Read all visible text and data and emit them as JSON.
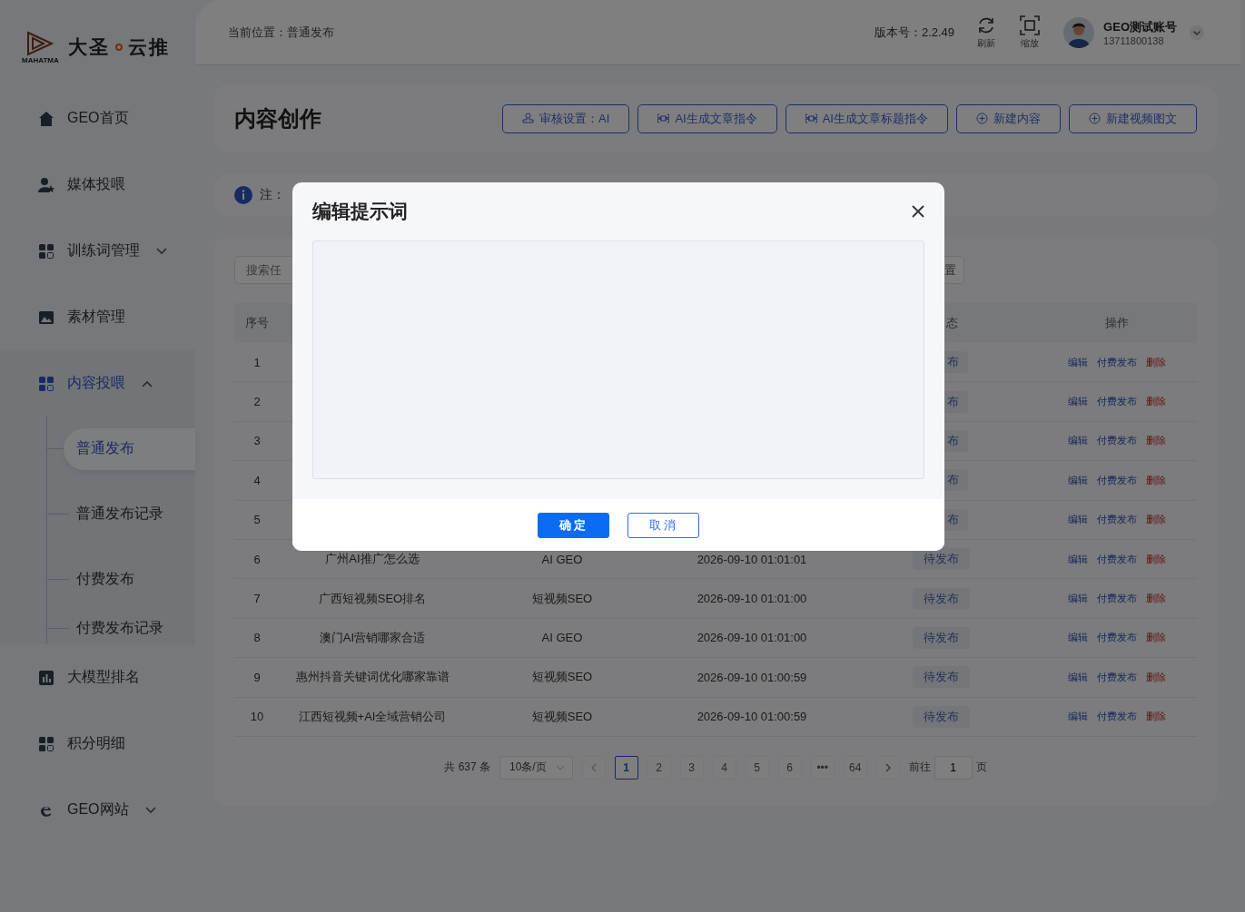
{
  "logo": {
    "caption": "MAHATMA",
    "name_left": "大圣",
    "name_right": "云推"
  },
  "sidebar": {
    "items": [
      {
        "label": "GEO首页",
        "selected": false
      },
      {
        "label": "媒体投喂",
        "selected": false
      },
      {
        "label": "训练词管理",
        "selected": false,
        "expanded": false
      },
      {
        "label": "素材管理",
        "selected": false
      },
      {
        "label": "内容投喂",
        "selected": true,
        "expanded": true,
        "children": [
          {
            "label": "普通发布",
            "selected": true
          },
          {
            "label": "普通发布记录",
            "selected": false
          },
          {
            "label": "付费发布",
            "selected": false
          },
          {
            "label": "付费发布记录",
            "selected": false
          }
        ]
      },
      {
        "label": "大模型排名",
        "selected": false
      },
      {
        "label": "积分明细",
        "selected": false
      },
      {
        "label": "GEO网站",
        "selected": false,
        "expanded": false
      }
    ]
  },
  "header": {
    "breadcrumb": "当前位置：普通发布",
    "version": "版本号：2.2.49",
    "tools": [
      "刷新",
      "缩放"
    ],
    "user": {
      "name": "GEO测试账号",
      "phone": "13711800138"
    }
  },
  "page_title": "内容创作",
  "actions": [
    "审核设置：AI",
    "AI生成文章指令",
    "AI生成文章标题指令",
    "新建内容",
    "新建视频图文"
  ],
  "notice": "注：",
  "search": {
    "placeholder": "搜索任",
    "button": "置"
  },
  "table": {
    "columns": [
      "序号",
      "态",
      "操作"
    ],
    "rows": [
      {
        "index": "1",
        "status": "布",
        "actions": [
          "编辑",
          "付费发布",
          "删除"
        ]
      },
      {
        "index": "2",
        "status": "布",
        "actions": [
          "编辑",
          "付费发布",
          "删除"
        ]
      },
      {
        "index": "3",
        "status": "布",
        "actions": [
          "编辑",
          "付费发布",
          "删除"
        ]
      },
      {
        "index": "4",
        "status": "布",
        "actions": [
          "编辑",
          "付费发布",
          "删除"
        ]
      },
      {
        "index": "5",
        "status": "布",
        "actions": [
          "编辑",
          "付费发布",
          "删除"
        ]
      },
      {
        "index": "6",
        "title": "广州AI推广怎么选",
        "type": "AI GEO",
        "time": "2026-09-10 01:01:01",
        "status": "待发布",
        "actions": [
          "编辑",
          "付费发布",
          "删除"
        ]
      },
      {
        "index": "7",
        "title": "广西短视频SEO排名",
        "type": "短视频SEO",
        "time": "2026-09-10 01:01:00",
        "status": "待发布",
        "actions": [
          "编辑",
          "付费发布",
          "删除"
        ]
      },
      {
        "index": "8",
        "title": "澳门AI营销哪家合适",
        "type": "AI GEO",
        "time": "2026-09-10 01:01:00",
        "status": "待发布",
        "actions": [
          "编辑",
          "付费发布",
          "删除"
        ]
      },
      {
        "index": "9",
        "title": "惠州抖音关键词优化哪家靠谱",
        "type": "短视频SEO",
        "time": "2026-09-10 01:00:59",
        "status": "待发布",
        "actions": [
          "编辑",
          "付费发布",
          "删除"
        ]
      },
      {
        "index": "10",
        "title": "江西短视频+AI全域营销公司",
        "type": "短视频SEO",
        "time": "2026-09-10 01:00:59",
        "status": "待发布",
        "actions": [
          "编辑",
          "付费发布",
          "删除"
        ]
      }
    ]
  },
  "pagination": {
    "total": "共 637 条",
    "page_size": "10条/页",
    "pages": [
      {
        "label": "1",
        "selected": true
      },
      {
        "label": "2",
        "selected": false
      },
      {
        "label": "3",
        "selected": false
      },
      {
        "label": "4",
        "selected": false
      },
      {
        "label": "5",
        "selected": false
      },
      {
        "label": "6",
        "selected": false
      },
      {
        "label": "•••",
        "selected": false
      },
      {
        "label": "64",
        "selected": false
      }
    ],
    "goto_label": "前往",
    "goto_value": "1",
    "goto_suffix": "页"
  },
  "dialog": {
    "title": "编辑提示词",
    "buttons": [
      "确定",
      "取消"
    ]
  }
}
